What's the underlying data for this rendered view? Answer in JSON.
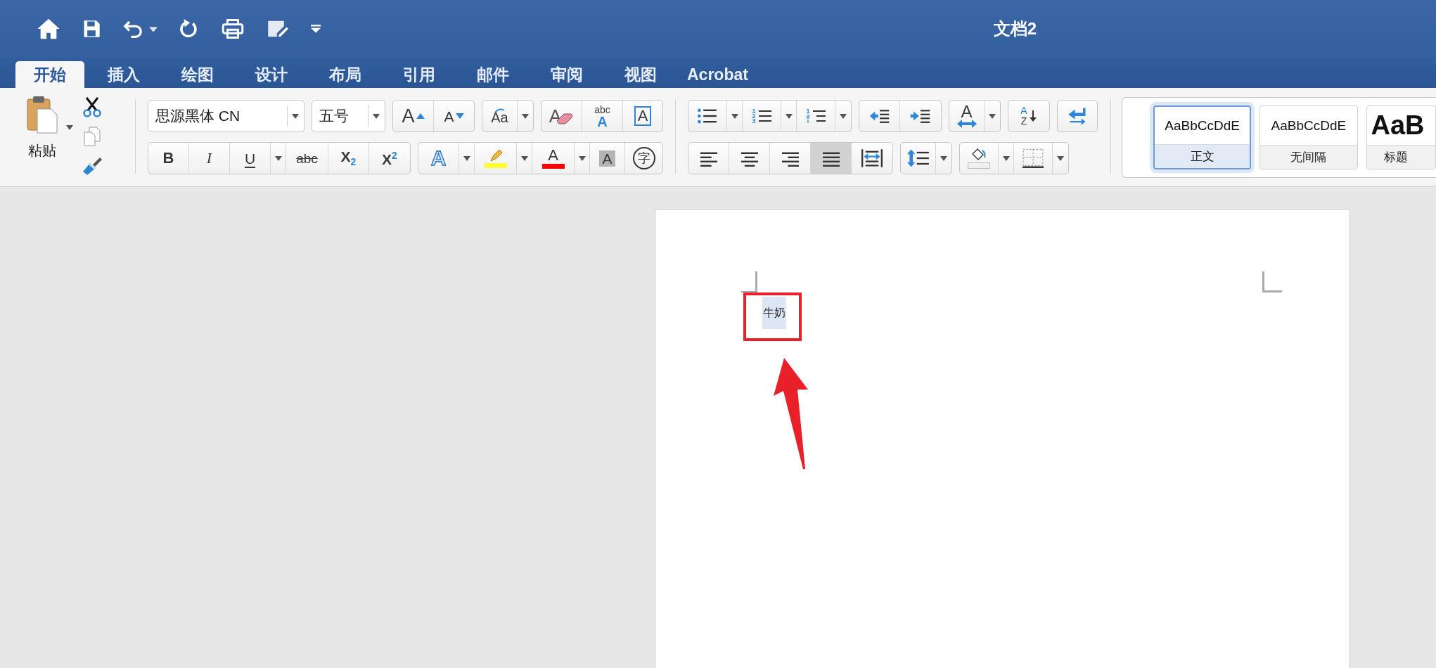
{
  "window": {
    "title": "文档2"
  },
  "tabs": [
    {
      "label": "开始",
      "selected": true
    },
    {
      "label": "插入",
      "selected": false
    },
    {
      "label": "绘图",
      "selected": false
    },
    {
      "label": "设计",
      "selected": false
    },
    {
      "label": "布局",
      "selected": false
    },
    {
      "label": "引用",
      "selected": false
    },
    {
      "label": "邮件",
      "selected": false
    },
    {
      "label": "审阅",
      "selected": false
    },
    {
      "label": "视图",
      "selected": false
    },
    {
      "label": "Acrobat",
      "selected": false
    }
  ],
  "clipboard": {
    "paste_label": "粘贴"
  },
  "font": {
    "name": "思源黑体 CN",
    "size": "五号",
    "rows": [
      [
        [
          {
            "kind": "grow",
            "label": "A"
          },
          {
            "kind": "shrink",
            "label": "A"
          }
        ],
        [
          {
            "kind": "case",
            "label": "Aa",
            "dropdown": true
          }
        ],
        [
          {
            "kind": "clear",
            "label": "A"
          },
          {
            "kind": "phonetic",
            "label": "abc",
            "label2": "A"
          },
          {
            "kind": "border",
            "label": "A"
          }
        ]
      ],
      [
        [
          {
            "kind": "bold",
            "label": "B"
          },
          {
            "kind": "italic",
            "label": "I"
          },
          {
            "kind": "underline",
            "label": "U",
            "dropdown": true
          },
          {
            "kind": "strike",
            "label": "abc"
          },
          {
            "kind": "sub",
            "label": "X$_{2}$"
          },
          {
            "kind": "sup",
            "label": "X$^{2}$"
          }
        ],
        [
          {
            "kind": "effects",
            "label": "A",
            "dropdown": true
          },
          {
            "kind": "highlight",
            "color": "#ffff33",
            "dropdown": true
          },
          {
            "kind": "fontcolor",
            "label": "A",
            "color": "#ff0000",
            "dropdown": true
          },
          {
            "kind": "shading",
            "label": "A"
          },
          {
            "kind": "enclose",
            "label": "字"
          }
        ]
      ]
    ]
  },
  "paragraph": {
    "rows": [
      [
        [
          {
            "kind": "bullets",
            "dropdown": true
          },
          {
            "kind": "numbering",
            "label": "123",
            "dropdown": true
          },
          {
            "kind": "multilevel",
            "label": "1ai",
            "dropdown": true
          }
        ],
        [
          {
            "kind": "outdent"
          },
          {
            "kind": "indent"
          }
        ],
        [
          {
            "kind": "direction",
            "label": "A",
            "dropdown": true
          }
        ],
        [
          {
            "kind": "sort",
            "label": "A",
            "label2": "Z"
          }
        ],
        [
          {
            "kind": "marks"
          }
        ]
      ],
      [
        [
          {
            "kind": "left",
            "selected": false
          },
          {
            "kind": "center",
            "selected": false
          },
          {
            "kind": "right",
            "selected": false
          },
          {
            "kind": "justify",
            "selected": true
          },
          {
            "kind": "distribute",
            "selected": false
          }
        ],
        [
          {
            "kind": "spacing",
            "dropdown": true
          }
        ],
        [
          {
            "kind": "fill",
            "dropdown": true
          },
          {
            "kind": "borders",
            "dropdown": true
          }
        ]
      ]
    ]
  },
  "styles": [
    {
      "sample": "AaBbCcDdE",
      "name": "正文",
      "kind": "body",
      "selected": true
    },
    {
      "sample": "AaBbCcDdE",
      "name": "无间隔",
      "kind": "body",
      "selected": false
    },
    {
      "sample": "AaB",
      "name": "标题",
      "kind": "heading",
      "selected": false
    }
  ],
  "document": {
    "text": "牛奶",
    "selected": true
  }
}
